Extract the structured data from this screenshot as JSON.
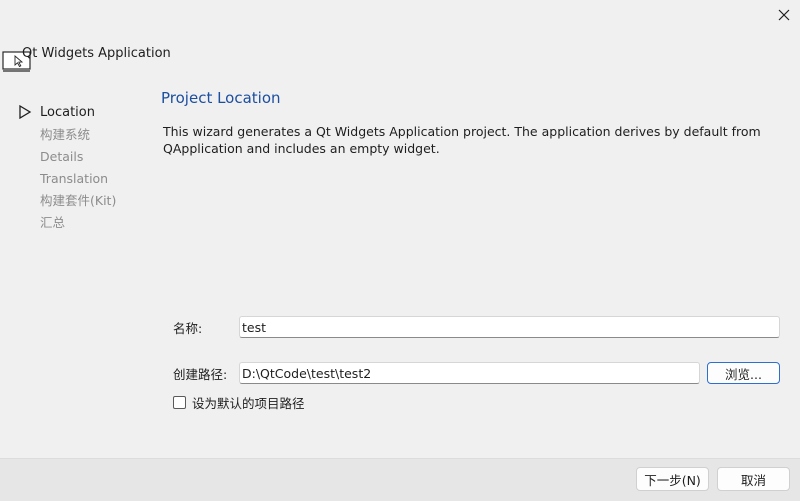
{
  "window": {
    "title": "Qt Widgets Application",
    "close_icon": "close-icon",
    "app_icon": "app-cursor-icon"
  },
  "steps": [
    {
      "label": "Location",
      "current": true
    },
    {
      "label": "构建系统",
      "current": false
    },
    {
      "label": "Details",
      "current": false
    },
    {
      "label": "Translation",
      "current": false
    },
    {
      "label": "构建套件(Kit)",
      "current": false
    },
    {
      "label": "汇总",
      "current": false
    }
  ],
  "page": {
    "title": "Project Location",
    "description": "This wizard generates a Qt Widgets Application project. The application derives by default from QApplication and includes an empty widget."
  },
  "form": {
    "name_label": "名称:",
    "name_value": "test",
    "path_label": "创建路径:",
    "path_value": "D:\\QtCode\\test\\test2",
    "browse_label": "浏览...",
    "default_path_label": "设为默认的项目路径",
    "default_path_checked": false
  },
  "footer": {
    "next_label": "下一步(N)",
    "cancel_label": "取消"
  },
  "colors": {
    "title_blue": "#1c4fa0",
    "focus_blue": "#2d6fd0",
    "background": "#f0f0f0"
  }
}
